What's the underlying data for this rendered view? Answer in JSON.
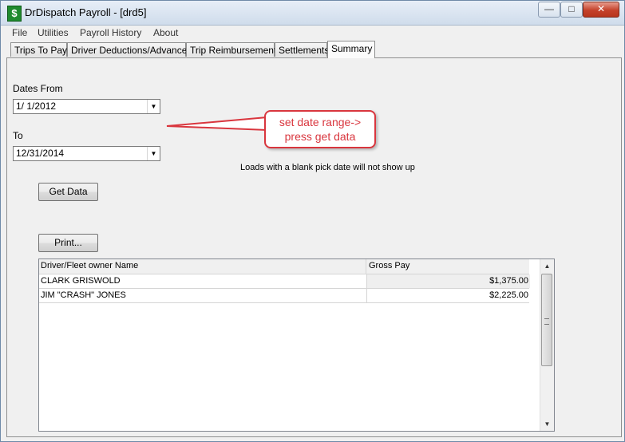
{
  "window": {
    "title": "DrDispatch Payroll - [drd5]",
    "icon": "dollar-icon",
    "controls": {
      "minimize": "—",
      "maximize": "□",
      "close": "✕"
    }
  },
  "menu": [
    "File",
    "Utilities",
    "Payroll History",
    "About"
  ],
  "tabs": [
    {
      "label": "Trips To Pay",
      "active": false
    },
    {
      "label": "Driver Deductions/Advances",
      "active": false
    },
    {
      "label": "Trip Reimbursements",
      "active": false
    },
    {
      "label": "Settlements",
      "active": false
    },
    {
      "label": "Summary",
      "active": true
    }
  ],
  "summary": {
    "dates_from_label": "Dates From",
    "dates_from_value": "1/  1/2012",
    "to_label": "To",
    "to_value": "12/31/2014",
    "callout": [
      "set date range->",
      "press get data"
    ],
    "note": "Loads with a blank pick date will not show up",
    "get_data_button": "Get Data",
    "print_button": "Print...",
    "grid": {
      "columns": [
        "Driver/Fleet owner Name",
        "Gross Pay"
      ],
      "rows": [
        {
          "name": "CLARK GRISWOLD",
          "gross_pay": "$1,375.00"
        },
        {
          "name": "JIM \"CRASH\" JONES",
          "gross_pay": "$2,225.00"
        }
      ]
    }
  },
  "colors": {
    "callout_accent": "#d9363e",
    "close_button": "#c4412a"
  }
}
